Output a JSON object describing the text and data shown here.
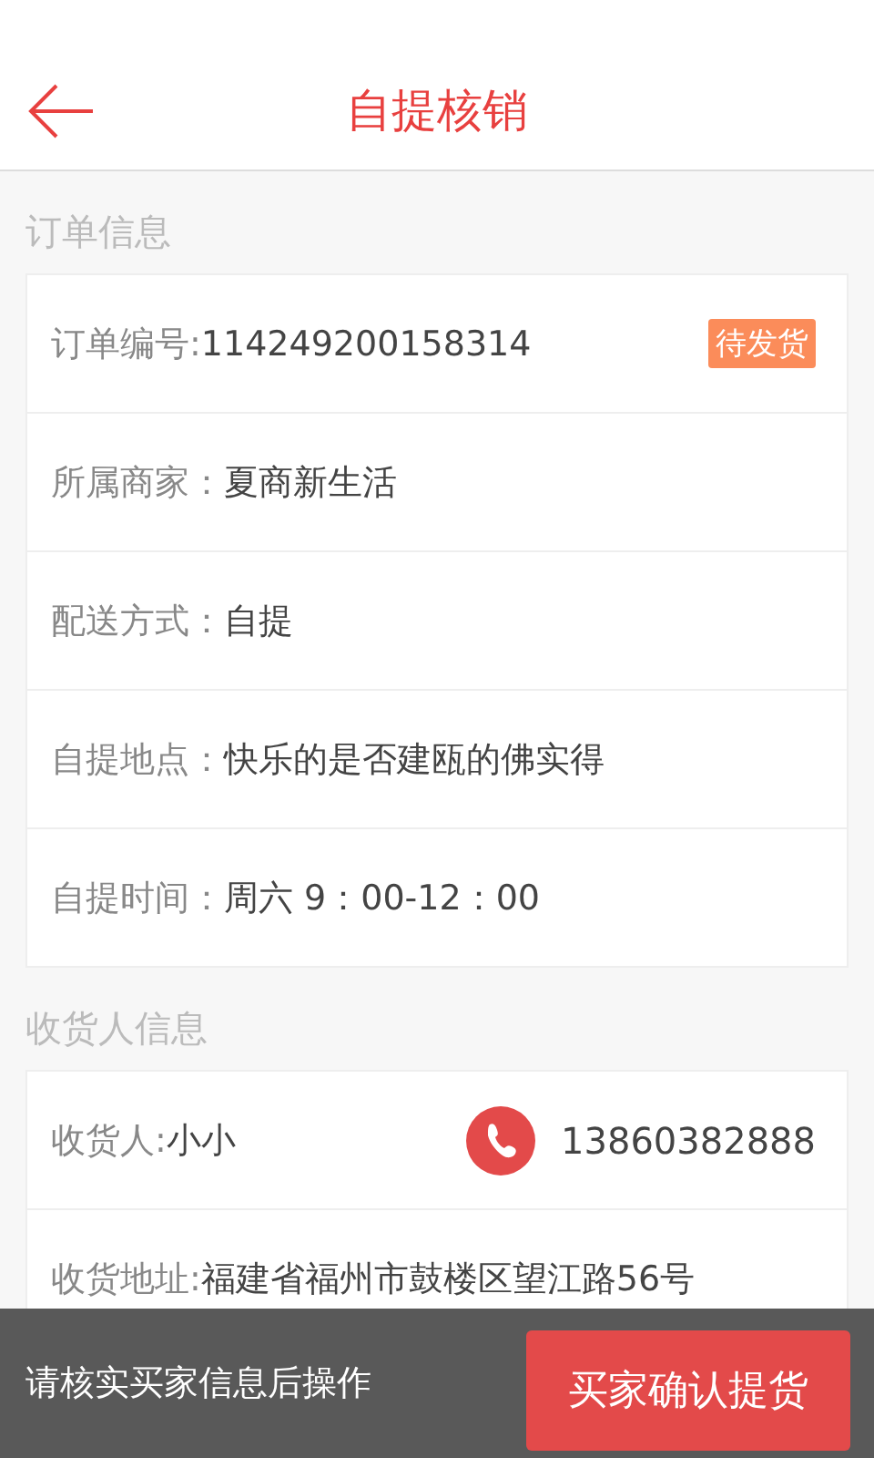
{
  "header": {
    "title": "自提核销"
  },
  "sections": [
    {
      "title": "订单信息",
      "rows": [
        {
          "kind": "text",
          "label": "订单编号:",
          "value": "114249200158314",
          "badge": "待发货"
        },
        {
          "kind": "text",
          "label": "所属商家：",
          "value": "夏商新生活"
        },
        {
          "kind": "text",
          "label": "配送方式：",
          "value": "自提"
        },
        {
          "kind": "text",
          "label": "自提地点：",
          "value": "快乐的是否建瓯的佛实得"
        },
        {
          "kind": "text",
          "label": "自提时间：",
          "value": "周六 9：00-12：00"
        }
      ]
    },
    {
      "title": "收货人信息",
      "rows": [
        {
          "kind": "contact",
          "label": "收货人:",
          "value": "小小",
          "phone": "13860382888"
        },
        {
          "kind": "text",
          "label": "收货地址:",
          "value": "福建省福州市鼓楼区望江路56号"
        }
      ]
    }
  ],
  "footer": {
    "hint": "请核实买家信息后操作",
    "button": "买家确认提货"
  }
}
